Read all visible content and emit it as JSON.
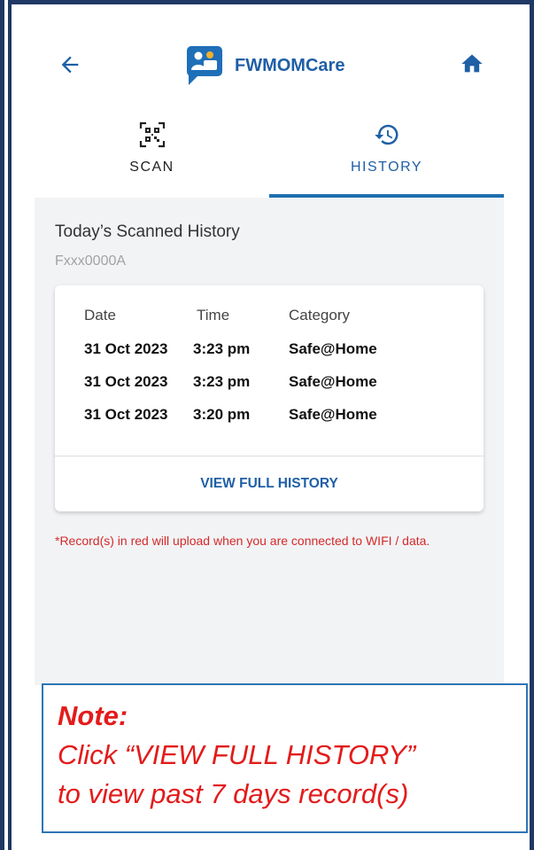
{
  "header": {
    "app_title": "FWMOMCare",
    "back_icon": "arrow-left-icon",
    "home_icon": "home-icon",
    "brand_color": "#1f5fa6"
  },
  "tabs": [
    {
      "label": "SCAN",
      "icon": "qr-code-icon",
      "active": false
    },
    {
      "label": "HISTORY",
      "icon": "history-icon",
      "active": true
    }
  ],
  "history": {
    "title": "Today’s Scanned History",
    "fin": "Fxxx0000A",
    "columns": [
      "Date",
      "Time",
      "Category"
    ],
    "rows": [
      {
        "date": "31 Oct 2023",
        "time": "3:23 pm",
        "category": "Safe@Home"
      },
      {
        "date": "31 Oct 2023",
        "time": "3:23 pm",
        "category": "Safe@Home"
      },
      {
        "date": "31 Oct 2023",
        "time": "3:20 pm",
        "category": "Safe@Home"
      }
    ],
    "view_full_label": "VIEW FULL HISTORY"
  },
  "warning": {
    "text": "*Record(s) in red will upload when you are connected to WIFI / data.",
    "color": "#d42a2a"
  },
  "note": {
    "title": "Note:",
    "line1": "Click “VIEW FULL HISTORY”",
    "line2": "to view past 7 days record(s)",
    "color": "#e31b1b"
  }
}
